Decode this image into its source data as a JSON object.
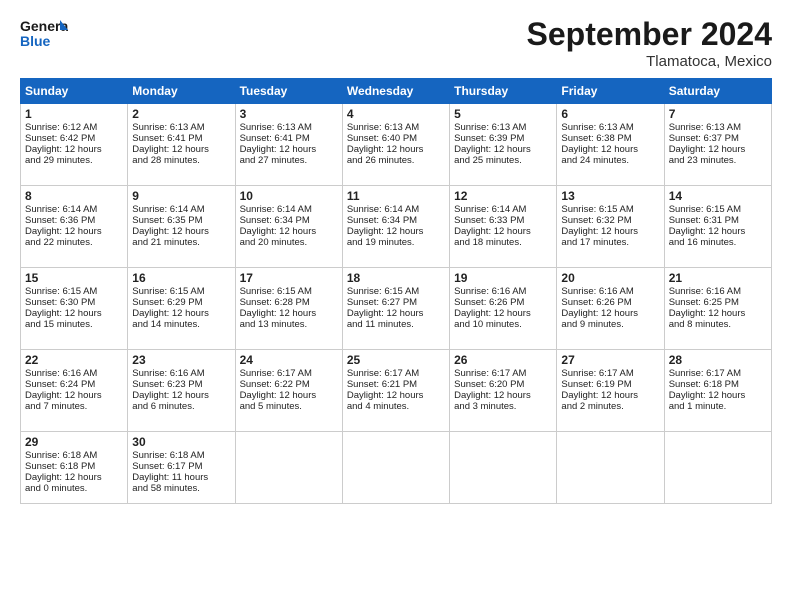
{
  "header": {
    "logo_line1": "General",
    "logo_line2": "Blue",
    "title": "September 2024",
    "location": "Tlamatoca, Mexico"
  },
  "days_of_week": [
    "Sunday",
    "Monday",
    "Tuesday",
    "Wednesday",
    "Thursday",
    "Friday",
    "Saturday"
  ],
  "weeks": [
    [
      {
        "day": "1",
        "lines": [
          "Sunrise: 6:12 AM",
          "Sunset: 6:42 PM",
          "Daylight: 12 hours",
          "and 29 minutes."
        ]
      },
      {
        "day": "2",
        "lines": [
          "Sunrise: 6:13 AM",
          "Sunset: 6:41 PM",
          "Daylight: 12 hours",
          "and 28 minutes."
        ]
      },
      {
        "day": "3",
        "lines": [
          "Sunrise: 6:13 AM",
          "Sunset: 6:41 PM",
          "Daylight: 12 hours",
          "and 27 minutes."
        ]
      },
      {
        "day": "4",
        "lines": [
          "Sunrise: 6:13 AM",
          "Sunset: 6:40 PM",
          "Daylight: 12 hours",
          "and 26 minutes."
        ]
      },
      {
        "day": "5",
        "lines": [
          "Sunrise: 6:13 AM",
          "Sunset: 6:39 PM",
          "Daylight: 12 hours",
          "and 25 minutes."
        ]
      },
      {
        "day": "6",
        "lines": [
          "Sunrise: 6:13 AM",
          "Sunset: 6:38 PM",
          "Daylight: 12 hours",
          "and 24 minutes."
        ]
      },
      {
        "day": "7",
        "lines": [
          "Sunrise: 6:13 AM",
          "Sunset: 6:37 PM",
          "Daylight: 12 hours",
          "and 23 minutes."
        ]
      }
    ],
    [
      {
        "day": "8",
        "lines": [
          "Sunrise: 6:14 AM",
          "Sunset: 6:36 PM",
          "Daylight: 12 hours",
          "and 22 minutes."
        ]
      },
      {
        "day": "9",
        "lines": [
          "Sunrise: 6:14 AM",
          "Sunset: 6:35 PM",
          "Daylight: 12 hours",
          "and 21 minutes."
        ]
      },
      {
        "day": "10",
        "lines": [
          "Sunrise: 6:14 AM",
          "Sunset: 6:34 PM",
          "Daylight: 12 hours",
          "and 20 minutes."
        ]
      },
      {
        "day": "11",
        "lines": [
          "Sunrise: 6:14 AM",
          "Sunset: 6:34 PM",
          "Daylight: 12 hours",
          "and 19 minutes."
        ]
      },
      {
        "day": "12",
        "lines": [
          "Sunrise: 6:14 AM",
          "Sunset: 6:33 PM",
          "Daylight: 12 hours",
          "and 18 minutes."
        ]
      },
      {
        "day": "13",
        "lines": [
          "Sunrise: 6:15 AM",
          "Sunset: 6:32 PM",
          "Daylight: 12 hours",
          "and 17 minutes."
        ]
      },
      {
        "day": "14",
        "lines": [
          "Sunrise: 6:15 AM",
          "Sunset: 6:31 PM",
          "Daylight: 12 hours",
          "and 16 minutes."
        ]
      }
    ],
    [
      {
        "day": "15",
        "lines": [
          "Sunrise: 6:15 AM",
          "Sunset: 6:30 PM",
          "Daylight: 12 hours",
          "and 15 minutes."
        ]
      },
      {
        "day": "16",
        "lines": [
          "Sunrise: 6:15 AM",
          "Sunset: 6:29 PM",
          "Daylight: 12 hours",
          "and 14 minutes."
        ]
      },
      {
        "day": "17",
        "lines": [
          "Sunrise: 6:15 AM",
          "Sunset: 6:28 PM",
          "Daylight: 12 hours",
          "and 13 minutes."
        ]
      },
      {
        "day": "18",
        "lines": [
          "Sunrise: 6:15 AM",
          "Sunset: 6:27 PM",
          "Daylight: 12 hours",
          "and 11 minutes."
        ]
      },
      {
        "day": "19",
        "lines": [
          "Sunrise: 6:16 AM",
          "Sunset: 6:26 PM",
          "Daylight: 12 hours",
          "and 10 minutes."
        ]
      },
      {
        "day": "20",
        "lines": [
          "Sunrise: 6:16 AM",
          "Sunset: 6:26 PM",
          "Daylight: 12 hours",
          "and 9 minutes."
        ]
      },
      {
        "day": "21",
        "lines": [
          "Sunrise: 6:16 AM",
          "Sunset: 6:25 PM",
          "Daylight: 12 hours",
          "and 8 minutes."
        ]
      }
    ],
    [
      {
        "day": "22",
        "lines": [
          "Sunrise: 6:16 AM",
          "Sunset: 6:24 PM",
          "Daylight: 12 hours",
          "and 7 minutes."
        ]
      },
      {
        "day": "23",
        "lines": [
          "Sunrise: 6:16 AM",
          "Sunset: 6:23 PM",
          "Daylight: 12 hours",
          "and 6 minutes."
        ]
      },
      {
        "day": "24",
        "lines": [
          "Sunrise: 6:17 AM",
          "Sunset: 6:22 PM",
          "Daylight: 12 hours",
          "and 5 minutes."
        ]
      },
      {
        "day": "25",
        "lines": [
          "Sunrise: 6:17 AM",
          "Sunset: 6:21 PM",
          "Daylight: 12 hours",
          "and 4 minutes."
        ]
      },
      {
        "day": "26",
        "lines": [
          "Sunrise: 6:17 AM",
          "Sunset: 6:20 PM",
          "Daylight: 12 hours",
          "and 3 minutes."
        ]
      },
      {
        "day": "27",
        "lines": [
          "Sunrise: 6:17 AM",
          "Sunset: 6:19 PM",
          "Daylight: 12 hours",
          "and 2 minutes."
        ]
      },
      {
        "day": "28",
        "lines": [
          "Sunrise: 6:17 AM",
          "Sunset: 6:18 PM",
          "Daylight: 12 hours",
          "and 1 minute."
        ]
      }
    ],
    [
      {
        "day": "29",
        "lines": [
          "Sunrise: 6:18 AM",
          "Sunset: 6:18 PM",
          "Daylight: 12 hours",
          "and 0 minutes."
        ]
      },
      {
        "day": "30",
        "lines": [
          "Sunrise: 6:18 AM",
          "Sunset: 6:17 PM",
          "Daylight: 11 hours",
          "and 58 minutes."
        ]
      },
      null,
      null,
      null,
      null,
      null
    ]
  ]
}
